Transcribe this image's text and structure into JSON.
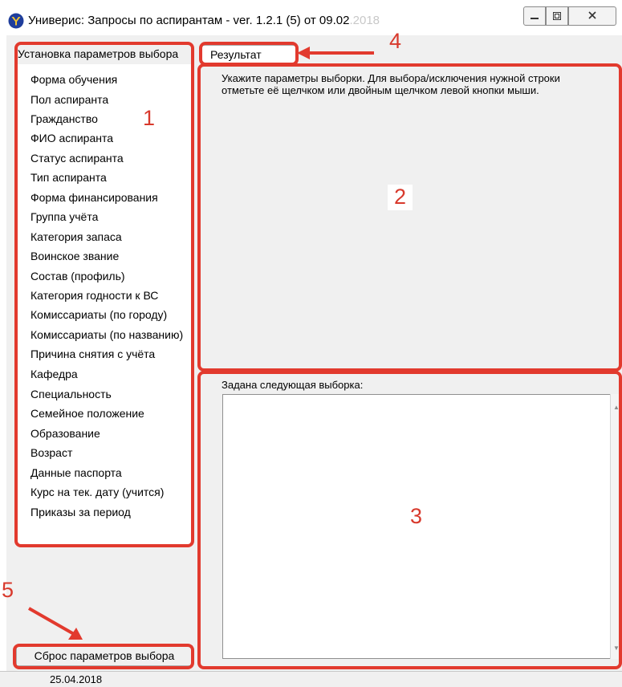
{
  "window": {
    "title": "Универис: Запросы по аспирантам  -  ver. 1.2.1 (5) от 09.02",
    "title_faded": ".2018",
    "icon": "univeris-logo-icon"
  },
  "left_panel": {
    "tab_label": "Установка параметров выбора",
    "items": [
      "Форма обучения",
      "Пол аспиранта",
      "Гражданство",
      "ФИО аспиранта",
      "Статус аспиранта",
      "Тип аспиранта",
      "Форма финансирования",
      "Группа учёта",
      "Категория запаса",
      "Воинское звание",
      "Состав (профиль)",
      "Категория годности к ВС",
      "Комиссариаты (по городу)",
      "Комиссариаты (по названию)",
      "Причина снятия с учёта",
      "Кафедра",
      "Специальность",
      "Семейное положение",
      "Образование",
      "Возраст",
      "Данные паспорта",
      "Курс на тек. дату (учится)",
      "Приказы за период"
    ],
    "reset_button": "Сброс параметров выбора"
  },
  "right_panel": {
    "tab_result": "Результат",
    "instructions_line1": "Укажите параметры выборки. Для выбора/исключения нужной строки",
    "instructions_line2": "отметьте её щелчком или двойным щелчком левой кнопки мыши.",
    "selection_label": "Задана следующая выборка:",
    "selection_value": ""
  },
  "status_bar": {
    "date": "25.04.2018"
  },
  "annotations": [
    "1",
    "2",
    "3",
    "4",
    "5"
  ],
  "colors": {
    "annotation": "#e23a2e",
    "window_bg": "#f0f0f0"
  }
}
